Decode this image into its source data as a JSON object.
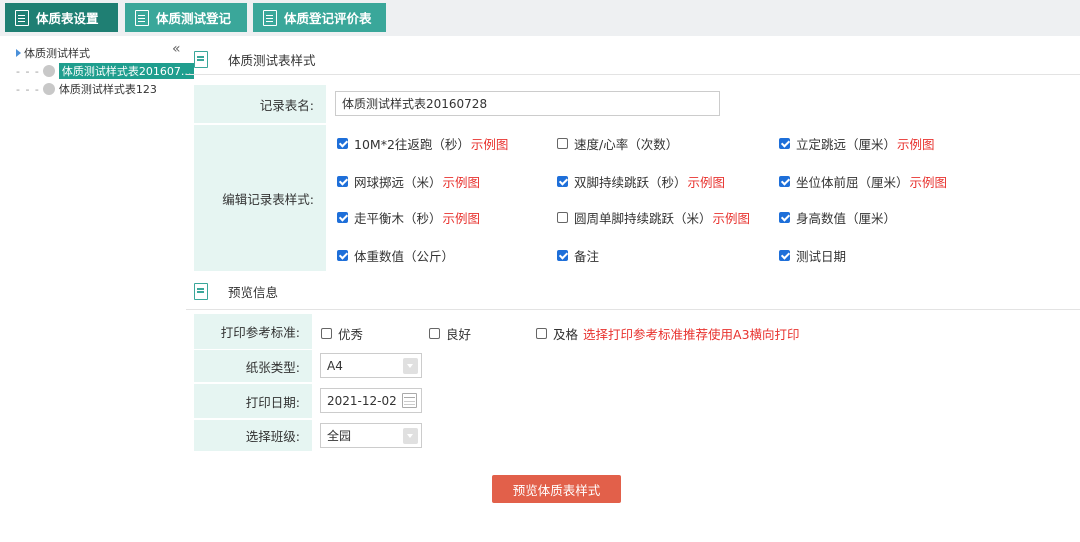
{
  "tabs": [
    {
      "label": "体质表设置"
    },
    {
      "label": "体质测试登记"
    },
    {
      "label": "体质登记评价表"
    }
  ],
  "sidebar": {
    "root_label": "体质测试样式",
    "collapse_glyph": "«",
    "items": [
      {
        "label": "体质测试样式表201607..."
      },
      {
        "label": "体质测试样式表123"
      }
    ]
  },
  "section1": {
    "title": "体质测试表样式",
    "record_name_label": "记录表名:",
    "record_name_value": "体质测试样式表20160728",
    "edit_style_label": "编辑记录表样式:",
    "example_link": "示例图",
    "options": [
      {
        "label": "10M*2往返跑（秒）",
        "checked": true
      },
      {
        "label": "速度/心率（次数）",
        "checked": false
      },
      {
        "label": "立定跳远（厘米）",
        "checked": true
      },
      {
        "label": "网球掷远（米）",
        "checked": true
      },
      {
        "label": "双脚持续跳跃（秒）",
        "checked": true
      },
      {
        "label": "坐位体前屈（厘米）",
        "checked": true
      },
      {
        "label": "走平衡木（秒）",
        "checked": true
      },
      {
        "label": "圆周单脚持续跳跃（米）",
        "checked": false
      },
      {
        "label": "身高数值（厘米）",
        "checked": true
      },
      {
        "label": "体重数值（公斤）",
        "checked": true
      },
      {
        "label": "备注",
        "checked": true
      },
      {
        "label": "测试日期",
        "checked": true
      }
    ]
  },
  "section2": {
    "title": "预览信息",
    "print_standard_label": "打印参考标准:",
    "standards": [
      {
        "label": "优秀",
        "checked": false
      },
      {
        "label": "良好",
        "checked": false
      },
      {
        "label": "及格",
        "checked": false
      }
    ],
    "print_hint": "选择打印参考标准推荐使用A3横向打印",
    "paper_label": "纸张类型:",
    "paper_value": "A4",
    "date_label": "打印日期:",
    "date_value": "2021-12-02",
    "class_label": "选择班级:",
    "class_value": "全园",
    "preview_button": "预览体质表样式"
  },
  "colors": {
    "tab": "#3aa79a",
    "tab_active": "#1f7f73",
    "label_bg": "#e6f5f2",
    "link": "#e8332f",
    "button": "#e2604a"
  }
}
